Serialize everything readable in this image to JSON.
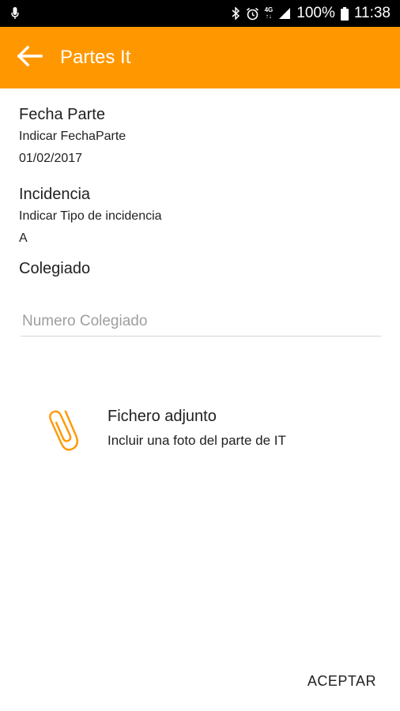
{
  "status_bar": {
    "network_label_top": "4G",
    "network_label_bottom": "↑↓",
    "battery_percent": "100%",
    "time": "11:38"
  },
  "app_bar": {
    "title": "Partes It",
    "back_icon": "arrow-back-icon"
  },
  "form": {
    "fecha": {
      "title": "Fecha Parte",
      "hint": "Indicar FechaParte",
      "value": "01/02/2017"
    },
    "incidencia": {
      "title": "Incidencia",
      "hint": "Indicar Tipo de incidencia",
      "value": "A"
    },
    "colegiado": {
      "title": "Colegiado",
      "input_value": "",
      "input_placeholder": "Numero Colegiado"
    }
  },
  "attachment": {
    "icon": "paperclip-icon",
    "title": "Fichero adjunto",
    "subtitle": "Incluir una foto del parte de IT"
  },
  "actions": {
    "accept_label": "ACEPTAR"
  },
  "colors": {
    "accent": "#ff9800",
    "status_bar": "#000000"
  }
}
